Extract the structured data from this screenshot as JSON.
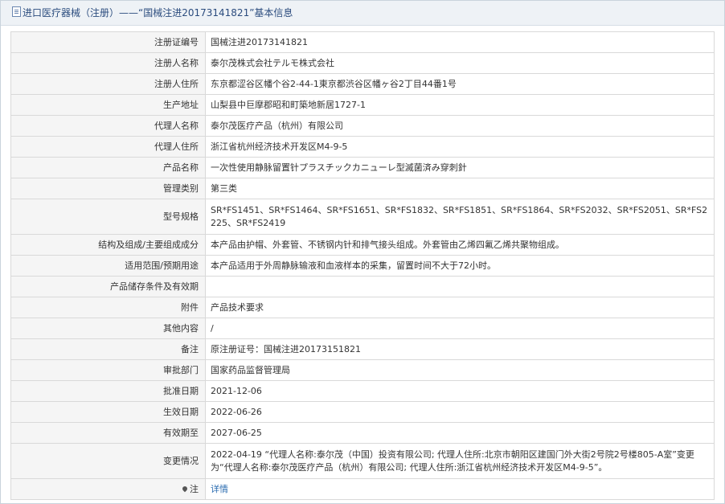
{
  "header": {
    "title": "进口医疗器械（注册）——“国械注进20173141821”基本信息",
    "icon": "document-icon"
  },
  "rows": [
    {
      "label": "注册证编号",
      "value": "国械注进20173141821"
    },
    {
      "label": "注册人名称",
      "value": "泰尔茂株式会社テルモ株式会社"
    },
    {
      "label": "注册人住所",
      "value": "东京都涩谷区幡个谷2-44-1東京都渋谷区幡ヶ谷2丁目44番1号"
    },
    {
      "label": "生产地址",
      "value": "山梨县中巨摩郡昭和町築地新居1727-1"
    },
    {
      "label": "代理人名称",
      "value": "泰尔茂医疗产品（杭州）有限公司"
    },
    {
      "label": "代理人住所",
      "value": "浙江省杭州经济技术开发区M4-9-5"
    },
    {
      "label": "产品名称",
      "value": "一次性使用静脉留置针プラスチックカニューレ型滅菌済み穿刺針"
    },
    {
      "label": "管理类别",
      "value": "第三类"
    },
    {
      "label": "型号规格",
      "value": "SR*FS1451、SR*FS1464、SR*FS1651、SR*FS1832、SR*FS1851、SR*FS1864、SR*FS2032、SR*FS2051、SR*FS2225、SR*FS2419"
    },
    {
      "label": "结构及组成/主要组成成分",
      "value": "本产品由护帽、外套管、不锈钢内针和排气接头组成。外套管由乙烯四氟乙烯共聚物组成。"
    },
    {
      "label": "适用范围/预期用途",
      "value": "本产品适用于外周静脉输液和血液样本的采集，留置时间不大于72小时。"
    },
    {
      "label": "产品储存条件及有效期",
      "value": ""
    },
    {
      "label": "附件",
      "value": "产品技术要求"
    },
    {
      "label": "其他内容",
      "value": "/"
    },
    {
      "label": "备注",
      "value": "原注册证号：国械注进20173151821"
    },
    {
      "label": "审批部门",
      "value": "国家药品监督管理局"
    },
    {
      "label": "批准日期",
      "value": "2021-12-06"
    },
    {
      "label": "生效日期",
      "value": "2022-06-26"
    },
    {
      "label": "有效期至",
      "value": "2027-06-25"
    },
    {
      "label": "变更情况",
      "value": "2022-04-19 “代理人名称:泰尔茂（中国）投资有限公司; 代理人住所:北京市朝阳区建国门外大街2号院2号楼805-A室”变更为“代理人名称:泰尔茂医疗产品（杭州）有限公司; 代理人住所:浙江省杭州经济技术开发区M4-9-5”。"
    }
  ],
  "note_row": {
    "label": "注",
    "icon": "pin-icon",
    "link": "详情"
  },
  "colors": {
    "title_bg": "#eef2f6",
    "title_text": "#2b4c7e",
    "label_bg": "#f5f5f5",
    "border": "#d9d9d9",
    "link": "#2b6cb0"
  }
}
